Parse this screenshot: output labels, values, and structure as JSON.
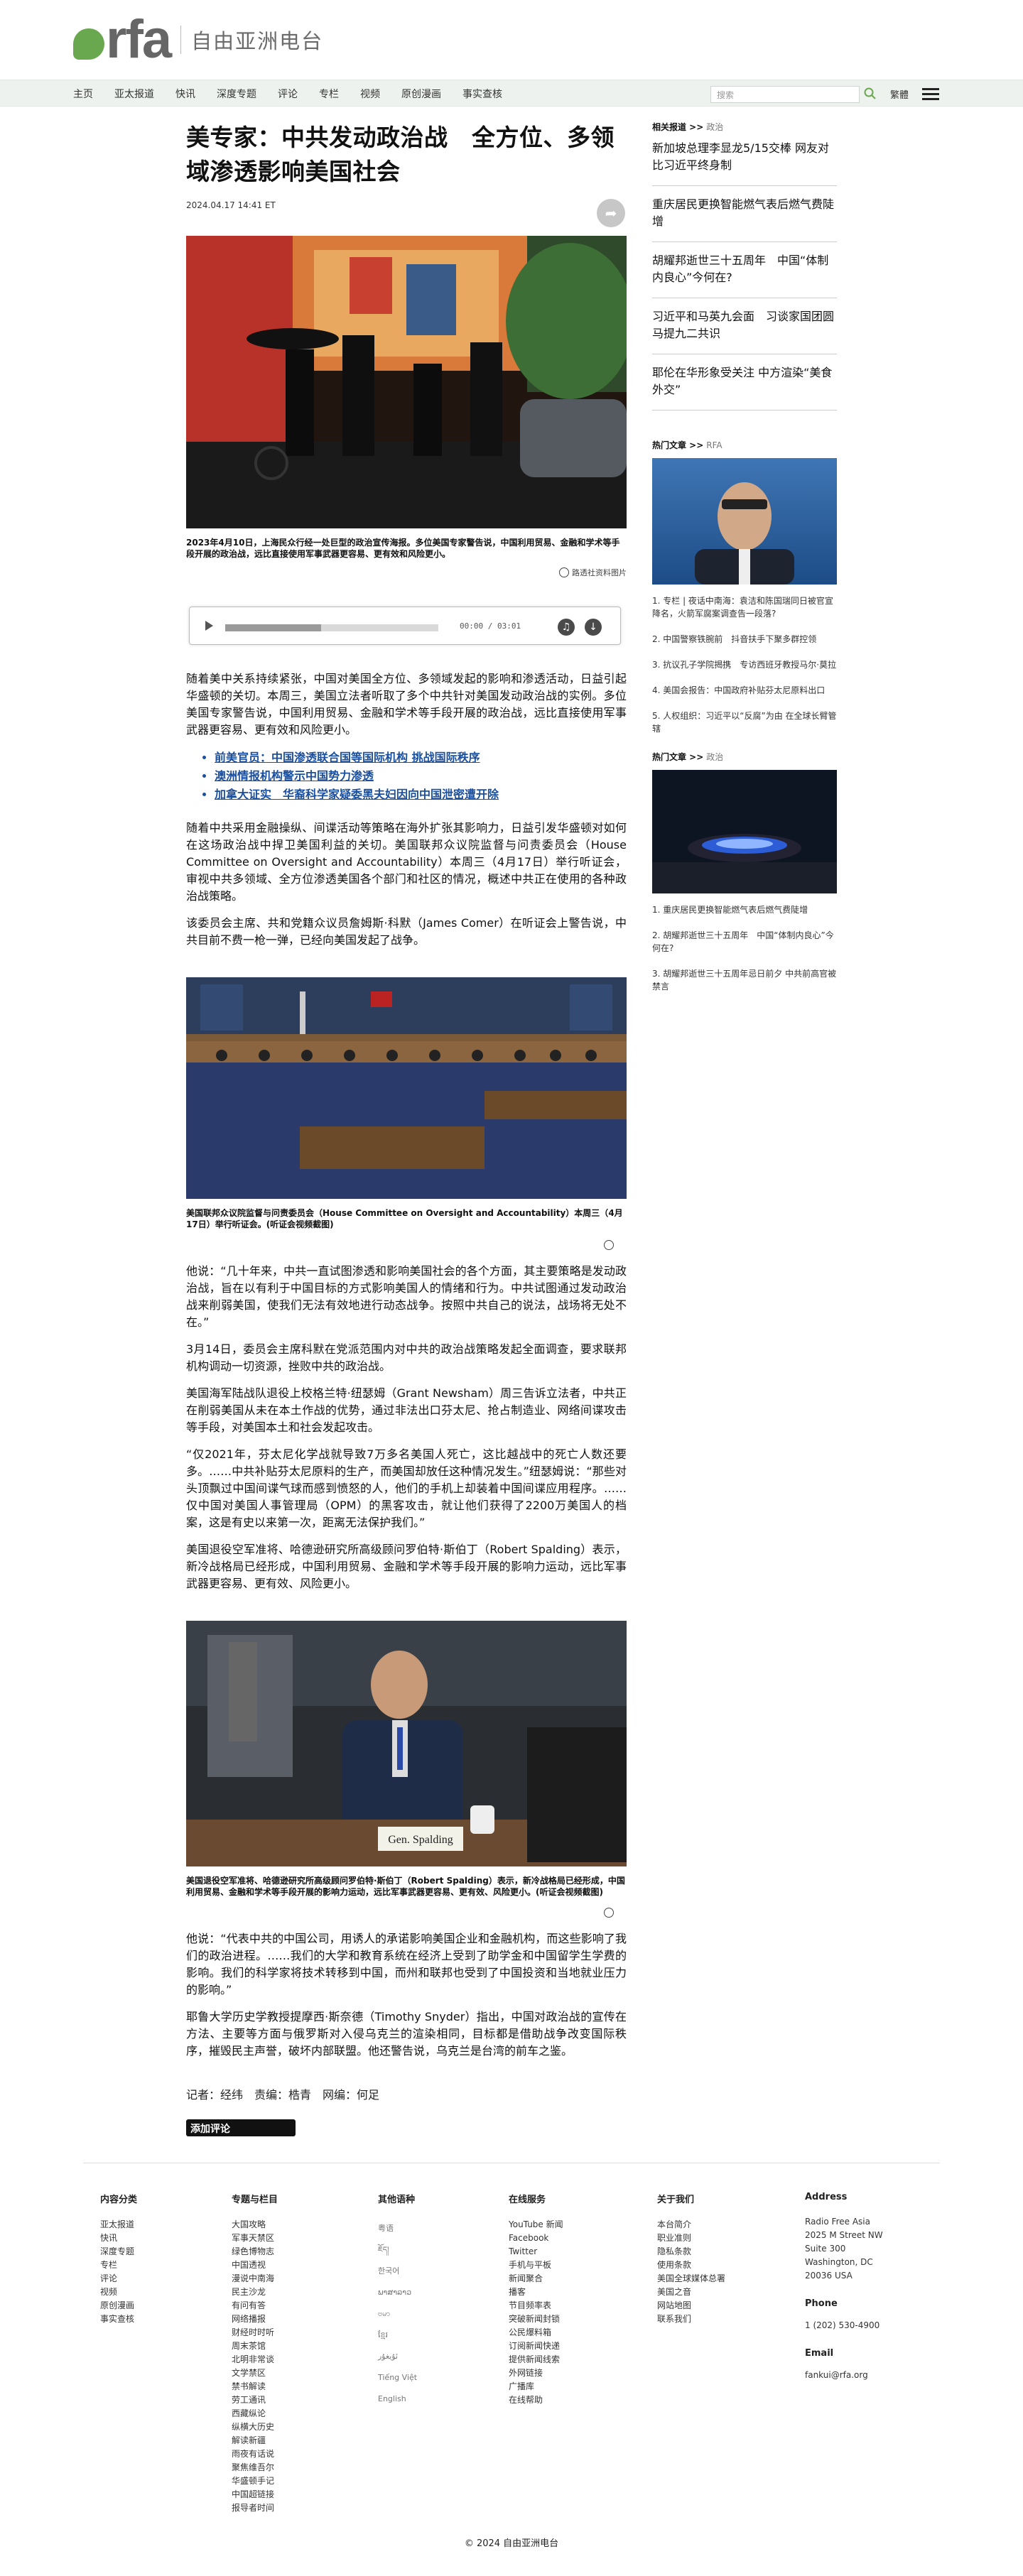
{
  "header": {
    "logo_text": "rfa",
    "logo_cn": "自由亚洲电台",
    "nav": [
      "主页",
      "亚太报道",
      "快讯",
      "深度专题",
      "评论",
      "专栏",
      "视频",
      "原创漫画",
      "事实查核"
    ],
    "search_placeholder": "搜索",
    "lang": "繁體"
  },
  "article": {
    "title": "美专家：中共发动政治战　全方位、多领域渗透影响美国社会",
    "date": "2024.04.17 14:41 ET",
    "photo1_caption": "2023年4月10日，上海民众行经一处巨型的政治宣传海报。多位美国专家警告说，中国利用贸易、金融和学术等手段开展的政治战，远比直接使用军事武器更容易、更有效和风险更小。",
    "photo1_credit": "路透社资料图片",
    "audio_time": "00:00 / 03:01",
    "audio_progress": 0.45,
    "p1": "随着美中关系持续紧张，中国对美国全方位、多领域发起的影响和渗透活动，日益引起华盛顿的关切。本周三，美国立法者听取了多个中共针对美国发动政治战的实例。多位美国专家警告说，中国利用贸易、金融和学术等手段开展的政治战，远比直接使用军事武器更容易、更有效和风险更小。",
    "related_links": [
      "前美官员：中国渗透联合国等国际机构 挑战国际秩序",
      "澳洲情报机构警示中国势力渗透",
      "加拿大证实　华裔科学家疑委黑夫妇因向中国泄密遭开除"
    ],
    "p2": "随着中共采用金融操纵、间谍活动等策略在海外扩张其影响力，日益引发华盛顿对如何在这场政治战中捍卫美国利益的关切。美国联邦众议院监督与问责委员会（House Committee on Oversight and Accountability）本周三（4月17日）举行听证会，审视中共多领域、全方位渗透美国各个部门和社区的情况，概述中共正在使用的各种政治战策略。",
    "p3": "该委员会主席、共和党籍众议员詹姆斯·科默（James Comer）在听证会上警告说，中共目前不费一枪一弹，已经向美国发起了战争。",
    "photo2_caption": "美国联邦众议院监督与问责委员会（House Committee on Oversight and Accountability）本周三（4月17日）举行听证会。(听证会视频截图)",
    "p4": "他说：“几十年来，中共一直试图渗透和影响美国社会的各个方面，其主要策略是发动政治战，旨在以有利于中国目标的方式影响美国人的情绪和行为。中共试图通过发动政治战来削弱美国，使我们无法有效地进行动态战争。按照中共自己的说法，战场将无处不在。”",
    "p5": "3月14日，委员会主席科默在党派范围内对中共的政治战策略发起全面调查，要求联邦机构调动一切资源，挫败中共的政治战。",
    "p6": "美国海军陆战队退役上校格兰特·纽瑟姆（Grant Newsham）周三告诉立法者，中共正在削弱美国从未在本土作战的优势，通过非法出口芬太尼、抢占制造业、网络间谍攻击等手段，对美国本土和社会发起攻击。",
    "p7": "“仅2021年，芬太尼化学战就导致7万多名美国人死亡，这比越战中的死亡人数还要多。……中共补贴芬太尼原料的生产，而美国却放任这种情况发生。”纽瑟姆说：“那些对头顶飘过中国间谍气球而感到愤怒的人，他们的手机上却装着中国间谍应用程序。……仅中国对美国人事管理局（OPM）的黑客攻击，就让他们获得了2200万美国人的档案，这是有史以来第一次，距离无法保护我们。”",
    "p8": "美国退役空军准将、哈德逊研究所高级顾问罗伯特·斯伯丁（Robert Spalding）表示，新冷战格局已经形成，中国利用贸易、金融和学术等手段开展的影响力运动，远比军事武器更容易、更有效、风险更小。",
    "photo3_caption": "美国退役空军准将、哈德逊研究所高级顾问罗伯特·斯伯丁（Robert Spalding）表示，新冷战格局已经形成，中国利用贸易、金融和学术等手段开展的影响力运动，远比军事武器更容易、更有效、风险更小。(听证会视频截图)",
    "nameplate": "Gen. Spalding",
    "p9": "他说：“代表中共的中国公司，用诱人的承诺影响美国企业和金融机构，而这些影响了我们的政治进程。……我们的大学和教育系统在经济上受到了助学金和中国留学生学费的影响。我们的科学家将技术转移到中国，而州和联邦也受到了中国投资和当地就业压力的影响。”",
    "p10": "耶鲁大学历史学教授提摩西·斯奈德（Timothy Snyder）指出，中国对政治战的宣传在方法、主要等方面与俄罗斯对入侵乌克兰的渲染相同，目标都是借助战争改变国际秩序，摧毁民主声誉，破坏内部联盟。他还警告说，乌克兰是台湾的前车之鉴。",
    "byline": "记者：经纬　责编：梏青　网编：何足",
    "comment_button": "添加评论"
  },
  "sidebar": {
    "related_head": "相关报道 >>",
    "related_sub": "政治",
    "related": [
      "新加坡总理李显龙5/15交棒 网友对比习近平终身制",
      "重庆居民更换智能燃气表后燃气费陡增",
      "胡耀邦逝世三十五周年　中国“体制内良心”今何在?",
      "习近平和马英九会面　习谈家国团圆 马提九二共识",
      "耶伦在华形象受关注 中方渲染“美食外交”"
    ],
    "hot_head": "热门文章 >>",
    "hot_sub": "RFA",
    "hot_list": [
      "1. 专栏 | 夜话中南海：袁洁和陈国瑞同日被官宣降名，火箭军腐案调查告一段落?",
      "2. 中国警察铁腕前　抖音扶手下聚多群控领",
      "3. 抗议孔子学院揭携　专访西班牙教授马尔·莫拉",
      "4. 美国会报告：中国政府补贴芬太尼原料出口",
      "5. 人权组织：习近平以“反腐”为由 在全球长臂管辖"
    ],
    "hot2_head": "热门文章 >>",
    "hot2_sub": "政治",
    "hot2_list": [
      "1. 重庆居民更换智能燃气表后燃气费陡增",
      "2. 胡耀邦逝世三十五周年　中国“体制内良心”今何在?",
      "3. 胡耀邦逝世三十五周年忌日前夕 中共前高官被禁言"
    ]
  },
  "footer": {
    "columns": [
      {
        "head": "内容分类",
        "items": [
          "亚太报道",
          "快讯",
          "深度专题",
          "专栏",
          "评论",
          "视频",
          "原创漫画",
          "事实查核"
        ]
      },
      {
        "head": "专题与栏目",
        "items": [
          "大国攻略",
          "军事天禁区",
          "绿色博物志",
          "中国透视",
          "漫说中南海",
          "民主沙龙",
          "有问有答",
          "网络播报",
          "财经时时听",
          "周末茶馆",
          "北明非常谈",
          "文学禁区",
          "禁书解读",
          "劳工通讯",
          "西藏纵论",
          "纵横大历史",
          "解读新疆",
          "雨夜有话说",
          "聚焦维吾尔",
          "华盛顿手记",
          "中国超链接",
          "报导者时间"
        ]
      },
      {
        "head": "其他语种",
        "items": [
          "粤语",
          "ཇོད།",
          "한국어",
          "ພາສາລາວ",
          "ဗမာ",
          "ខ្មែរ",
          "ئۇيغۇر",
          "Tiếng Việt",
          "English"
        ]
      },
      {
        "head": "在线服务",
        "items": [
          "YouTube 新闻",
          "Facebook",
          "Twitter",
          "手机与平板",
          "新闻聚合",
          "播客",
          "节目频率表",
          "突破新闻封锁",
          "公民爆料箱",
          "订阅新闻快递",
          "提供新闻线索",
          "外网链接",
          "广播库",
          "在线帮助"
        ]
      },
      {
        "head": "关于我们",
        "items": [
          "本台简介",
          "职业准则",
          "隐私条款",
          "使用条款",
          "美国全球媒体总署",
          "美国之音",
          "网站地图",
          "联系我们"
        ]
      },
      {
        "head": "Address",
        "items": [
          "Radio Free Asia",
          "2025 M Street NW",
          "Suite 300",
          "Washington, DC",
          "20036 USA"
        ]
      }
    ],
    "phone_head": "Phone",
    "phone": "1 (202) 530-4900",
    "email_head": "Email",
    "email": "fankui@rfa.org",
    "copyright": "© 2024 自由亚洲电台"
  }
}
